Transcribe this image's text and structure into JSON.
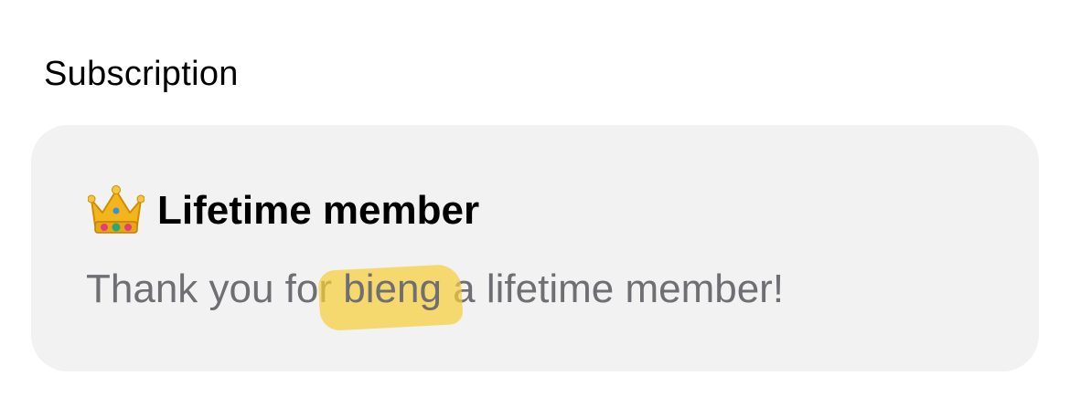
{
  "section": {
    "title": "Subscription"
  },
  "card": {
    "title": "Lifetime member",
    "icon": "crown-icon",
    "message_before": "Thank you for",
    "message_highlight": "bieng",
    "message_after": "a lifetime member!"
  },
  "colors": {
    "card_background": "#f2f2f2",
    "body_text": "#6e6e73",
    "highlight": "#f5cd3a"
  }
}
